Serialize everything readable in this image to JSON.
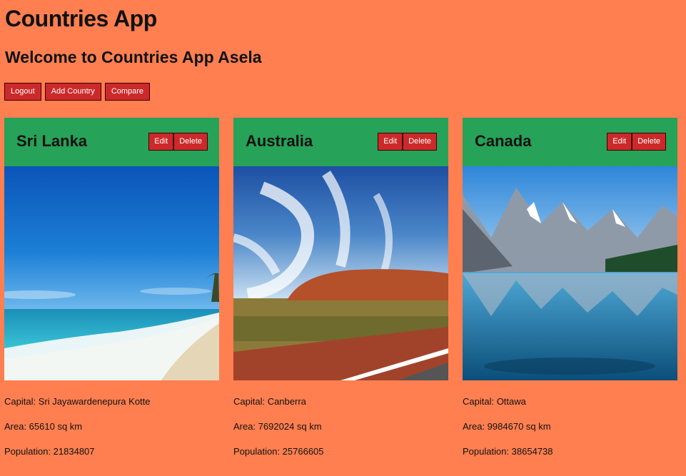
{
  "app": {
    "title": "Countries App",
    "welcome": "Welcome to Countries App Asela"
  },
  "nav": {
    "logout_label": "Logout",
    "add_label": "Add Country",
    "compare_label": "Compare"
  },
  "colors": {
    "page_bg": "#FF7F50",
    "card_header": "#26A259",
    "button": "#CC2A2A"
  },
  "cards": [
    {
      "name": "Sri Lanka",
      "edit_label": "Edit",
      "delete_label": "Delete",
      "capital": "Capital: Sri Jayawardenepura Kotte",
      "area": "Area: 65610 sq km",
      "population": "Population: 21834807"
    },
    {
      "name": "Australia",
      "edit_label": "Edit",
      "delete_label": "Delete",
      "capital": "Capital: Canberra",
      "area": "Area: 7692024 sq km",
      "population": "Population: 25766605"
    },
    {
      "name": "Canada",
      "edit_label": "Edit",
      "delete_label": "Delete",
      "capital": "Capital: Ottawa",
      "area": "Area: 9984670 sq km",
      "population": "Population: 38654738"
    }
  ]
}
